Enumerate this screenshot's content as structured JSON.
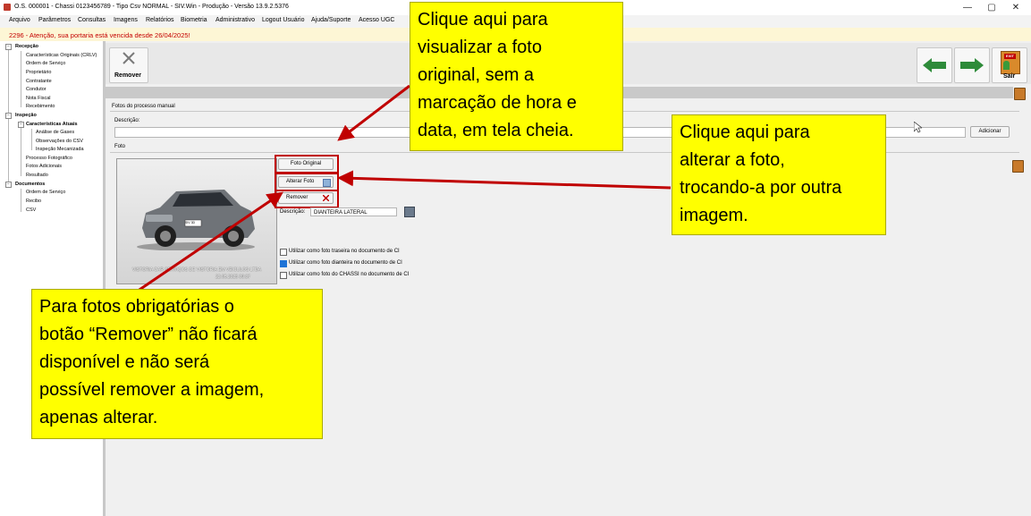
{
  "window": {
    "title": "O.S. 000001 - Chassi 0123456789 - Tipo Csv NORMAL - SIV.Win - Produção - Versão 13.9.2.5376",
    "controls": [
      "—",
      "▢",
      "✕"
    ]
  },
  "menu": [
    "Arquivo",
    "Parâmetros",
    "Consultas",
    "Imagens",
    "Relatórios",
    "Biometria",
    "Administrativo",
    "Logout Usuário",
    "Ajuda/Suporte",
    "Acesso UGC"
  ],
  "alert": "2296 - Atenção, sua portaria está vencida desde 26/04/2025!",
  "sidebar": {
    "recepcao": "Recepção",
    "recepcao_items": [
      "Características Originais (CRLV)",
      "Ordem de Serviço",
      "Proprietário",
      "Contratante",
      "Condutor",
      "Nota Fiscal",
      "Recebimento"
    ],
    "inspecao": "Inspeção",
    "caracteristicas_atuais": "Características Atuais",
    "caracteristicas_items": [
      "Análise de Gases",
      "Observações do CSV",
      "Inspeção Mecanizada"
    ],
    "inspecao_items": [
      "Processo Fotográfico",
      "Fotos Adicionais",
      "Resultado"
    ],
    "documentos": "Documentos",
    "documentos_items": [
      "Ordem de Serviço",
      "Recibo",
      "CSV"
    ]
  },
  "toolbar": {
    "remover_label": "Remover",
    "sair_label": "Sair",
    "exit_sign": "EXIT"
  },
  "form": {
    "section_label": "Fotos do processo manual",
    "descricao_label": "Descrição:",
    "adicionar_label": "Adicionar",
    "foto_label": "Foto",
    "foto_original_label": "Foto Original",
    "alterar_foto_label": "Alterar Foto",
    "remover_label": "Remover",
    "descricao2_label": "Descrição:",
    "descricao2_value": "DIANTEIRA LATERAL",
    "photo_watermark_line1": "VISTORIA CAR SERVIÇOS DE VISTORIA EM VEICULOS LTDA",
    "photo_watermark_line2": "22.05.2025 09:37",
    "plate_text": "SIV 3D",
    "checkbox_traseira": "Utilizar como foto traseira no documento de CI",
    "checkbox_dianteira": "Utilizar como foto dianteira no documento de CI",
    "checkbox_chassi": "Utilizar como foto do CHASSI no documento de CI",
    "checkbox_dianteira_checked": true
  },
  "callouts": {
    "foto_original": [
      "Clique aqui para",
      "visualizar a foto",
      "original, sem a",
      "marcação de hora e",
      "data, em tela cheia."
    ],
    "alterar_foto": [
      "Clique aqui para",
      "alterar a foto,",
      "trocando-a por outra",
      "imagem."
    ],
    "remover": [
      "Para fotos obrigatórias o",
      "botão “Remover” não ficará",
      "disponível e não será",
      "possível remover a imagem,",
      "apenas alterar."
    ]
  },
  "colors": {
    "callout_bg": "#ffff00",
    "highlight_red": "#c00000",
    "alert_text": "#c40000",
    "arrow_green": "#2e8b3a"
  }
}
